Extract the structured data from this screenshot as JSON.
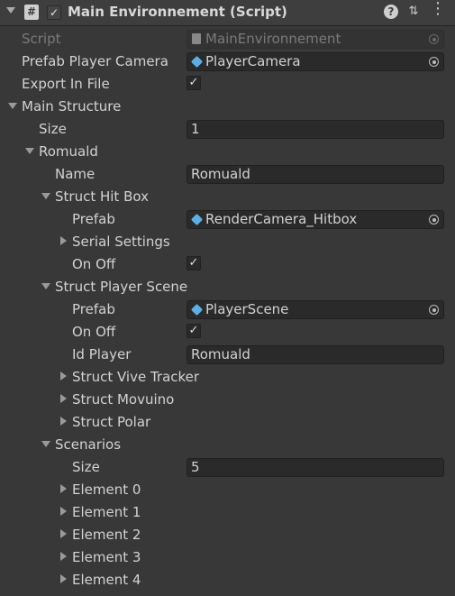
{
  "header": {
    "title": "Main Environnement (Script)",
    "enabled_mark": "✓",
    "help_glyph": "?",
    "presets_glyph": "⇅",
    "more_glyph": "⋮"
  },
  "colors": {
    "background": "#383838",
    "field": "#2a2a2a",
    "text": "#d2d2d2",
    "dim_text": "#7a7a7a",
    "prefab_icon": "#5ab0e6"
  },
  "fields": {
    "script": {
      "label": "Script",
      "value": "MainEnvironnement"
    },
    "prefab_player_camera": {
      "label": "Prefab Player Camera",
      "value": "PlayerCamera"
    },
    "export_in_file": {
      "label": "Export In File",
      "check": "✓"
    },
    "main_structure": {
      "label": "Main Structure"
    },
    "size": {
      "label": "Size",
      "value": "1"
    },
    "romuald": {
      "label": "Romuald"
    },
    "name": {
      "label": "Name",
      "value": "Romuald"
    },
    "struct_hit_box": {
      "label": "Struct Hit Box"
    },
    "hitbox_prefab": {
      "label": "Prefab",
      "value": "RenderCamera_Hitbox"
    },
    "serial_settings": {
      "label": "Serial Settings"
    },
    "hitbox_on_off": {
      "label": "On Off",
      "check": "✓"
    },
    "struct_player_scene": {
      "label": "Struct Player Scene"
    },
    "scene_prefab": {
      "label": "Prefab",
      "value": "PlayerScene"
    },
    "scene_on_off": {
      "label": "On Off",
      "check": "✓"
    },
    "id_player": {
      "label": "Id Player",
      "value": "Romuald"
    },
    "struct_vive_tracker": {
      "label": "Struct Vive Tracker"
    },
    "struct_movuino": {
      "label": "Struct Movuino"
    },
    "struct_polar": {
      "label": "Struct Polar"
    },
    "scenarios": {
      "label": "Scenarios"
    },
    "scenarios_size": {
      "label": "Size",
      "value": "5"
    },
    "elements": [
      "Element 0",
      "Element 1",
      "Element 2",
      "Element 3",
      "Element 4"
    ]
  }
}
